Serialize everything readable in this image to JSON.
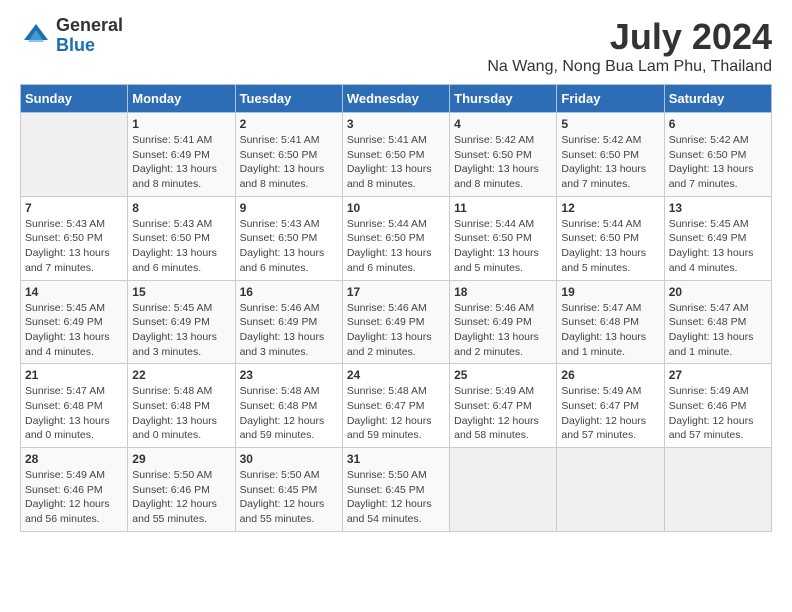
{
  "logo": {
    "general": "General",
    "blue": "Blue"
  },
  "title": "July 2024",
  "subtitle": "Na Wang, Nong Bua Lam Phu, Thailand",
  "headers": [
    "Sunday",
    "Monday",
    "Tuesday",
    "Wednesday",
    "Thursday",
    "Friday",
    "Saturday"
  ],
  "weeks": [
    [
      {
        "day": "",
        "info": ""
      },
      {
        "day": "1",
        "info": "Sunrise: 5:41 AM\nSunset: 6:49 PM\nDaylight: 13 hours\nand 8 minutes."
      },
      {
        "day": "2",
        "info": "Sunrise: 5:41 AM\nSunset: 6:50 PM\nDaylight: 13 hours\nand 8 minutes."
      },
      {
        "day": "3",
        "info": "Sunrise: 5:41 AM\nSunset: 6:50 PM\nDaylight: 13 hours\nand 8 minutes."
      },
      {
        "day": "4",
        "info": "Sunrise: 5:42 AM\nSunset: 6:50 PM\nDaylight: 13 hours\nand 8 minutes."
      },
      {
        "day": "5",
        "info": "Sunrise: 5:42 AM\nSunset: 6:50 PM\nDaylight: 13 hours\nand 7 minutes."
      },
      {
        "day": "6",
        "info": "Sunrise: 5:42 AM\nSunset: 6:50 PM\nDaylight: 13 hours\nand 7 minutes."
      }
    ],
    [
      {
        "day": "7",
        "info": "Sunrise: 5:43 AM\nSunset: 6:50 PM\nDaylight: 13 hours\nand 7 minutes."
      },
      {
        "day": "8",
        "info": "Sunrise: 5:43 AM\nSunset: 6:50 PM\nDaylight: 13 hours\nand 6 minutes."
      },
      {
        "day": "9",
        "info": "Sunrise: 5:43 AM\nSunset: 6:50 PM\nDaylight: 13 hours\nand 6 minutes."
      },
      {
        "day": "10",
        "info": "Sunrise: 5:44 AM\nSunset: 6:50 PM\nDaylight: 13 hours\nand 6 minutes."
      },
      {
        "day": "11",
        "info": "Sunrise: 5:44 AM\nSunset: 6:50 PM\nDaylight: 13 hours\nand 5 minutes."
      },
      {
        "day": "12",
        "info": "Sunrise: 5:44 AM\nSunset: 6:50 PM\nDaylight: 13 hours\nand 5 minutes."
      },
      {
        "day": "13",
        "info": "Sunrise: 5:45 AM\nSunset: 6:49 PM\nDaylight: 13 hours\nand 4 minutes."
      }
    ],
    [
      {
        "day": "14",
        "info": "Sunrise: 5:45 AM\nSunset: 6:49 PM\nDaylight: 13 hours\nand 4 minutes."
      },
      {
        "day": "15",
        "info": "Sunrise: 5:45 AM\nSunset: 6:49 PM\nDaylight: 13 hours\nand 3 minutes."
      },
      {
        "day": "16",
        "info": "Sunrise: 5:46 AM\nSunset: 6:49 PM\nDaylight: 13 hours\nand 3 minutes."
      },
      {
        "day": "17",
        "info": "Sunrise: 5:46 AM\nSunset: 6:49 PM\nDaylight: 13 hours\nand 2 minutes."
      },
      {
        "day": "18",
        "info": "Sunrise: 5:46 AM\nSunset: 6:49 PM\nDaylight: 13 hours\nand 2 minutes."
      },
      {
        "day": "19",
        "info": "Sunrise: 5:47 AM\nSunset: 6:48 PM\nDaylight: 13 hours\nand 1 minute."
      },
      {
        "day": "20",
        "info": "Sunrise: 5:47 AM\nSunset: 6:48 PM\nDaylight: 13 hours\nand 1 minute."
      }
    ],
    [
      {
        "day": "21",
        "info": "Sunrise: 5:47 AM\nSunset: 6:48 PM\nDaylight: 13 hours\nand 0 minutes."
      },
      {
        "day": "22",
        "info": "Sunrise: 5:48 AM\nSunset: 6:48 PM\nDaylight: 13 hours\nand 0 minutes."
      },
      {
        "day": "23",
        "info": "Sunrise: 5:48 AM\nSunset: 6:48 PM\nDaylight: 12 hours\nand 59 minutes."
      },
      {
        "day": "24",
        "info": "Sunrise: 5:48 AM\nSunset: 6:47 PM\nDaylight: 12 hours\nand 59 minutes."
      },
      {
        "day": "25",
        "info": "Sunrise: 5:49 AM\nSunset: 6:47 PM\nDaylight: 12 hours\nand 58 minutes."
      },
      {
        "day": "26",
        "info": "Sunrise: 5:49 AM\nSunset: 6:47 PM\nDaylight: 12 hours\nand 57 minutes."
      },
      {
        "day": "27",
        "info": "Sunrise: 5:49 AM\nSunset: 6:46 PM\nDaylight: 12 hours\nand 57 minutes."
      }
    ],
    [
      {
        "day": "28",
        "info": "Sunrise: 5:49 AM\nSunset: 6:46 PM\nDaylight: 12 hours\nand 56 minutes."
      },
      {
        "day": "29",
        "info": "Sunrise: 5:50 AM\nSunset: 6:46 PM\nDaylight: 12 hours\nand 55 minutes."
      },
      {
        "day": "30",
        "info": "Sunrise: 5:50 AM\nSunset: 6:45 PM\nDaylight: 12 hours\nand 55 minutes."
      },
      {
        "day": "31",
        "info": "Sunrise: 5:50 AM\nSunset: 6:45 PM\nDaylight: 12 hours\nand 54 minutes."
      },
      {
        "day": "",
        "info": ""
      },
      {
        "day": "",
        "info": ""
      },
      {
        "day": "",
        "info": ""
      }
    ]
  ]
}
